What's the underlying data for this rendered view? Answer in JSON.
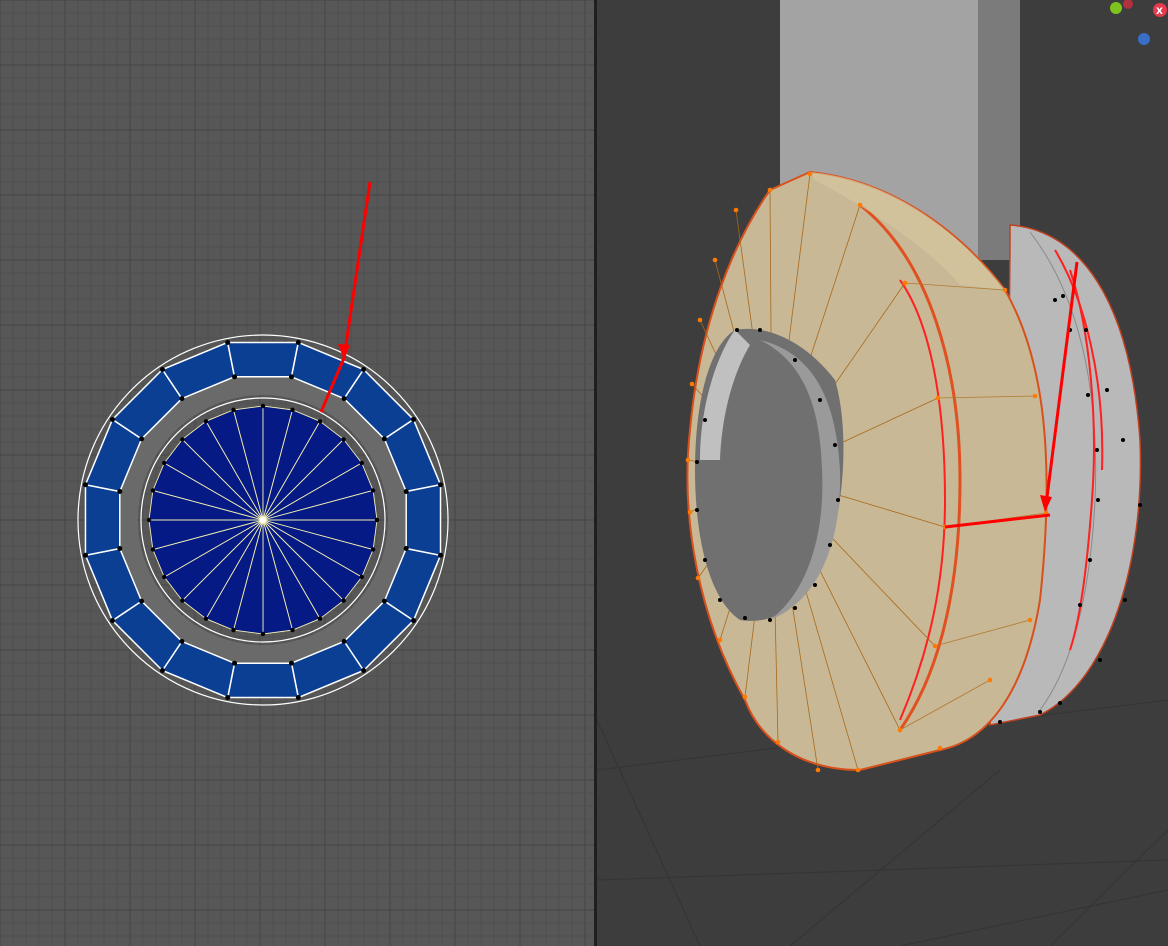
{
  "colors": {
    "uv_background": "#575757",
    "uv_grid_minor": "#4f4f4f",
    "uv_grid_major": "#464646",
    "uv_face_outer": "#0a3f93",
    "uv_face_inner": "#061a86",
    "uv_edge": "#ffffff",
    "uv_vertex": "#000000",
    "viewport_background": "#3d3d3d",
    "mesh_selected": "#c9b895",
    "mesh_unselected": "#b9b9b9",
    "selected_edge": "#ff7a00",
    "seam": "#ff2020",
    "annotation": "#ff0000",
    "gizmo_y": "#7dc21e",
    "gizmo_x": "#e33a4e",
    "gizmo_z": "#3a6fc8"
  },
  "viewport": {
    "gizmo": {
      "x_label": "X"
    }
  },
  "icons": {
    "annotation": "arrow-icon",
    "gizmo": "axis-gizmo-icon"
  }
}
